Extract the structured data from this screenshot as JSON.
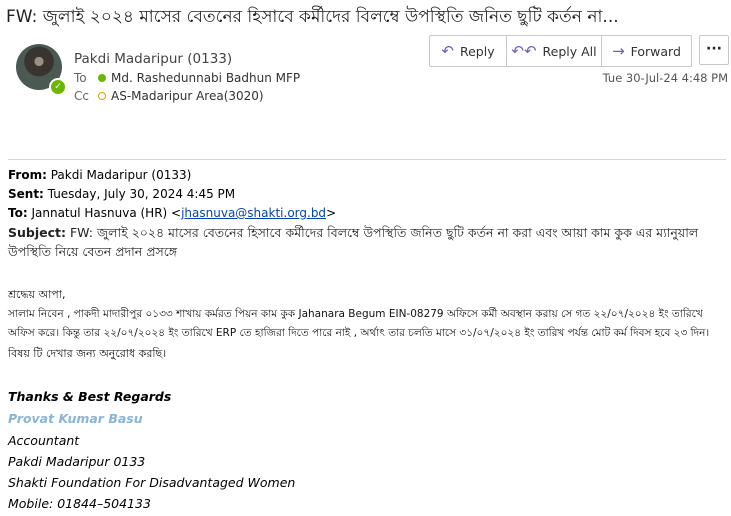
{
  "email": {
    "subject": "FW: জুলাই ২০২৪ মাসের বেতনের হিসাবে কর্মীদের বিলম্বে উপস্থিতি জনিত ছুটি কর্তন না...",
    "sender": "Pakdi Madaripur (0133)",
    "to_label": "To",
    "to_value": "Md. Rashedunnabi Badhun MFP",
    "cc_label": "Cc",
    "cc_value": "AS-Madaripur Area(3020)",
    "date": "Tue 30-Jul-24 4:48 PM"
  },
  "toolbar": {
    "reply_label": "Reply",
    "reply_all_label": "Reply All",
    "forward_label": "Forward",
    "more_label": "···"
  },
  "forwarded": {
    "from_label": "From:",
    "from_value": "Pakdi Madaripur (0133)",
    "sent_label": "Sent:",
    "sent_value": "Tuesday, July 30, 2024 4:45 PM",
    "to_label": "To:",
    "to_name": "Jannatul Hasnuva (HR) <",
    "to_email": "jhasnuva@shakti.org.bd",
    "to_close": ">",
    "subject_label": "Subject:",
    "subject_value": "FW: জুলাই ২০২৪ মাসের বেতনের হিসাবে কর্মীদের বিলম্বে উপস্থিতি জনিত ছুটি কর্তন না করা এবং আয়া কাম কুক এর ম্যানুয়াল উপস্থিতি নিয়ে বেতন প্রদান প্রসঙ্গে"
  },
  "body": {
    "greeting": "শ্রদ্ধেয় আপা,",
    "line1": "সালাম নিবেন , পাকদী মাদারীপুর ০১৩৩ শাখায় কর্মরত পিয়ন কাম কুক Jahanara  Begum  EIN-08279 অফিসে কর্মী অবস্থান করায় সে গত ২২/০৭/২০২৪ ইং তারিখে",
    "line2": "অফিস করে। কিন্তু তার ২২/০৭/২০২৪ ইং তারিখে ERP তে হাজিরা দিতে পারে নাই , অর্থাৎ তার চলতি মাসে ৩১/০৭/২০২৪ ইং তারিখ পর্যন্ত মোট কর্ম দিবস হবে ২৩ দিন।",
    "line3": "বিষয় টি দেখার জন্য অনুরোধ করছি।"
  },
  "signature": {
    "regards": "Thanks & Best Regards",
    "name": "Provat Kumar Basu",
    "title": "Accountant",
    "branch": "Pakdi  Madaripur  0133",
    "org": "Shakti  Foundation  For  Disadvantaged  Women",
    "mobile": "Mobile:  01844–504133"
  },
  "colors": {
    "accent": "#6b5fbf",
    "presence": "#6bb700",
    "cc_dot": "#e8a200",
    "link": "#0645ad",
    "signature_name": "#8ab4d8"
  }
}
